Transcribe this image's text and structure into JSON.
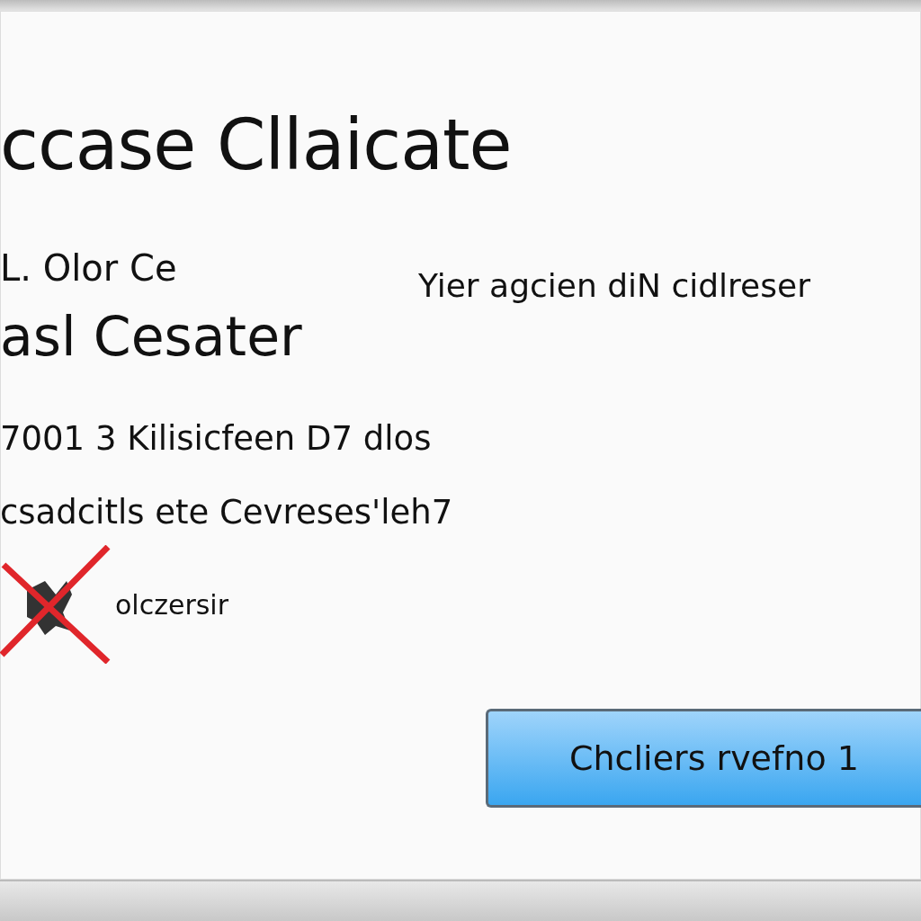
{
  "dialog": {
    "title": "ccase Cllaicate",
    "subtitle": "L. Olor Ce",
    "side_note": "Yier agcien diN cidlreser",
    "heading": "asl Cesater",
    "lines": [
      "7001 3 Kilisicfeen D7 dlos",
      "csadcitls ete Cevreses'leh7"
    ],
    "error_label": "olczersir",
    "button": "Chcliers rvefno 1"
  }
}
